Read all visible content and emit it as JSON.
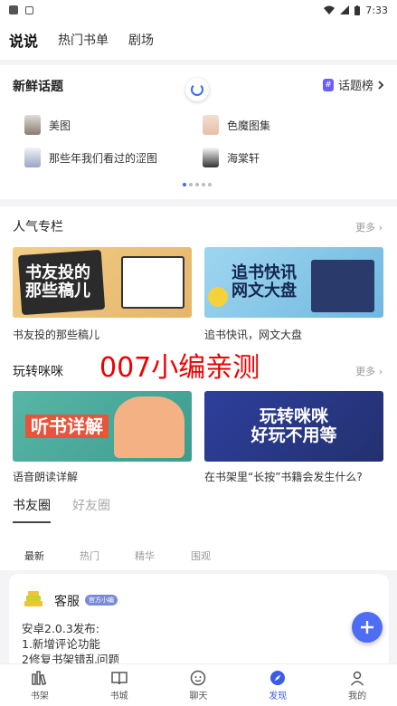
{
  "status_bar": {
    "time": "7:33"
  },
  "top_tabs": [
    {
      "label": "说说",
      "active": true
    },
    {
      "label": "热门书单",
      "active": false
    },
    {
      "label": "剧场",
      "active": false
    }
  ],
  "fresh_topics": {
    "title": "新鲜话题",
    "rank_badge": "#",
    "rank_label": "话题榜",
    "items": [
      "美图",
      "色魔图集",
      "那些年我们看过的涩图",
      "海棠轩"
    ],
    "page_count": 5,
    "active_page": 1
  },
  "columns": {
    "title": "人气专栏",
    "more": "更多",
    "items": [
      {
        "banner_text": "书友投的\n那些稿儿",
        "caption": "书友投的那些稿儿"
      },
      {
        "banner_text": "追书快讯\n网文大盘",
        "caption": "追书快讯，网文大盘"
      }
    ]
  },
  "watermark": "007小编亲测",
  "mimi": {
    "title": "玩转咪咪",
    "more": "更多",
    "items": [
      {
        "banner_text": "听书详解",
        "caption": "语音朗读详解"
      },
      {
        "banner_text": "玩转咪咪\n好玩不用等",
        "caption": "在书架里“长按”书籍会发生什么?"
      }
    ]
  },
  "friends": {
    "tabs": [
      "书友圈",
      "好友圈"
    ],
    "subtabs": [
      "最新",
      "热门",
      "精华",
      "围观"
    ]
  },
  "post": {
    "author": "客服",
    "badge": "官方小编",
    "lines": [
      "安卓2.0.3发布:",
      "1.新增评论功能",
      "2修复书架错乱问题"
    ]
  },
  "bottom_nav": [
    {
      "label": "书架",
      "icon": "bookshelf-icon",
      "active": false
    },
    {
      "label": "书城",
      "icon": "book-icon",
      "active": false
    },
    {
      "label": "聊天",
      "icon": "chat-icon",
      "active": false
    },
    {
      "label": "发现",
      "icon": "compass-icon",
      "active": true
    },
    {
      "label": "我的",
      "icon": "user-icon",
      "active": false
    }
  ],
  "colors": {
    "accent": "#3a5ce8",
    "fab": "#4f6cf5",
    "watermark": "#e00000"
  }
}
